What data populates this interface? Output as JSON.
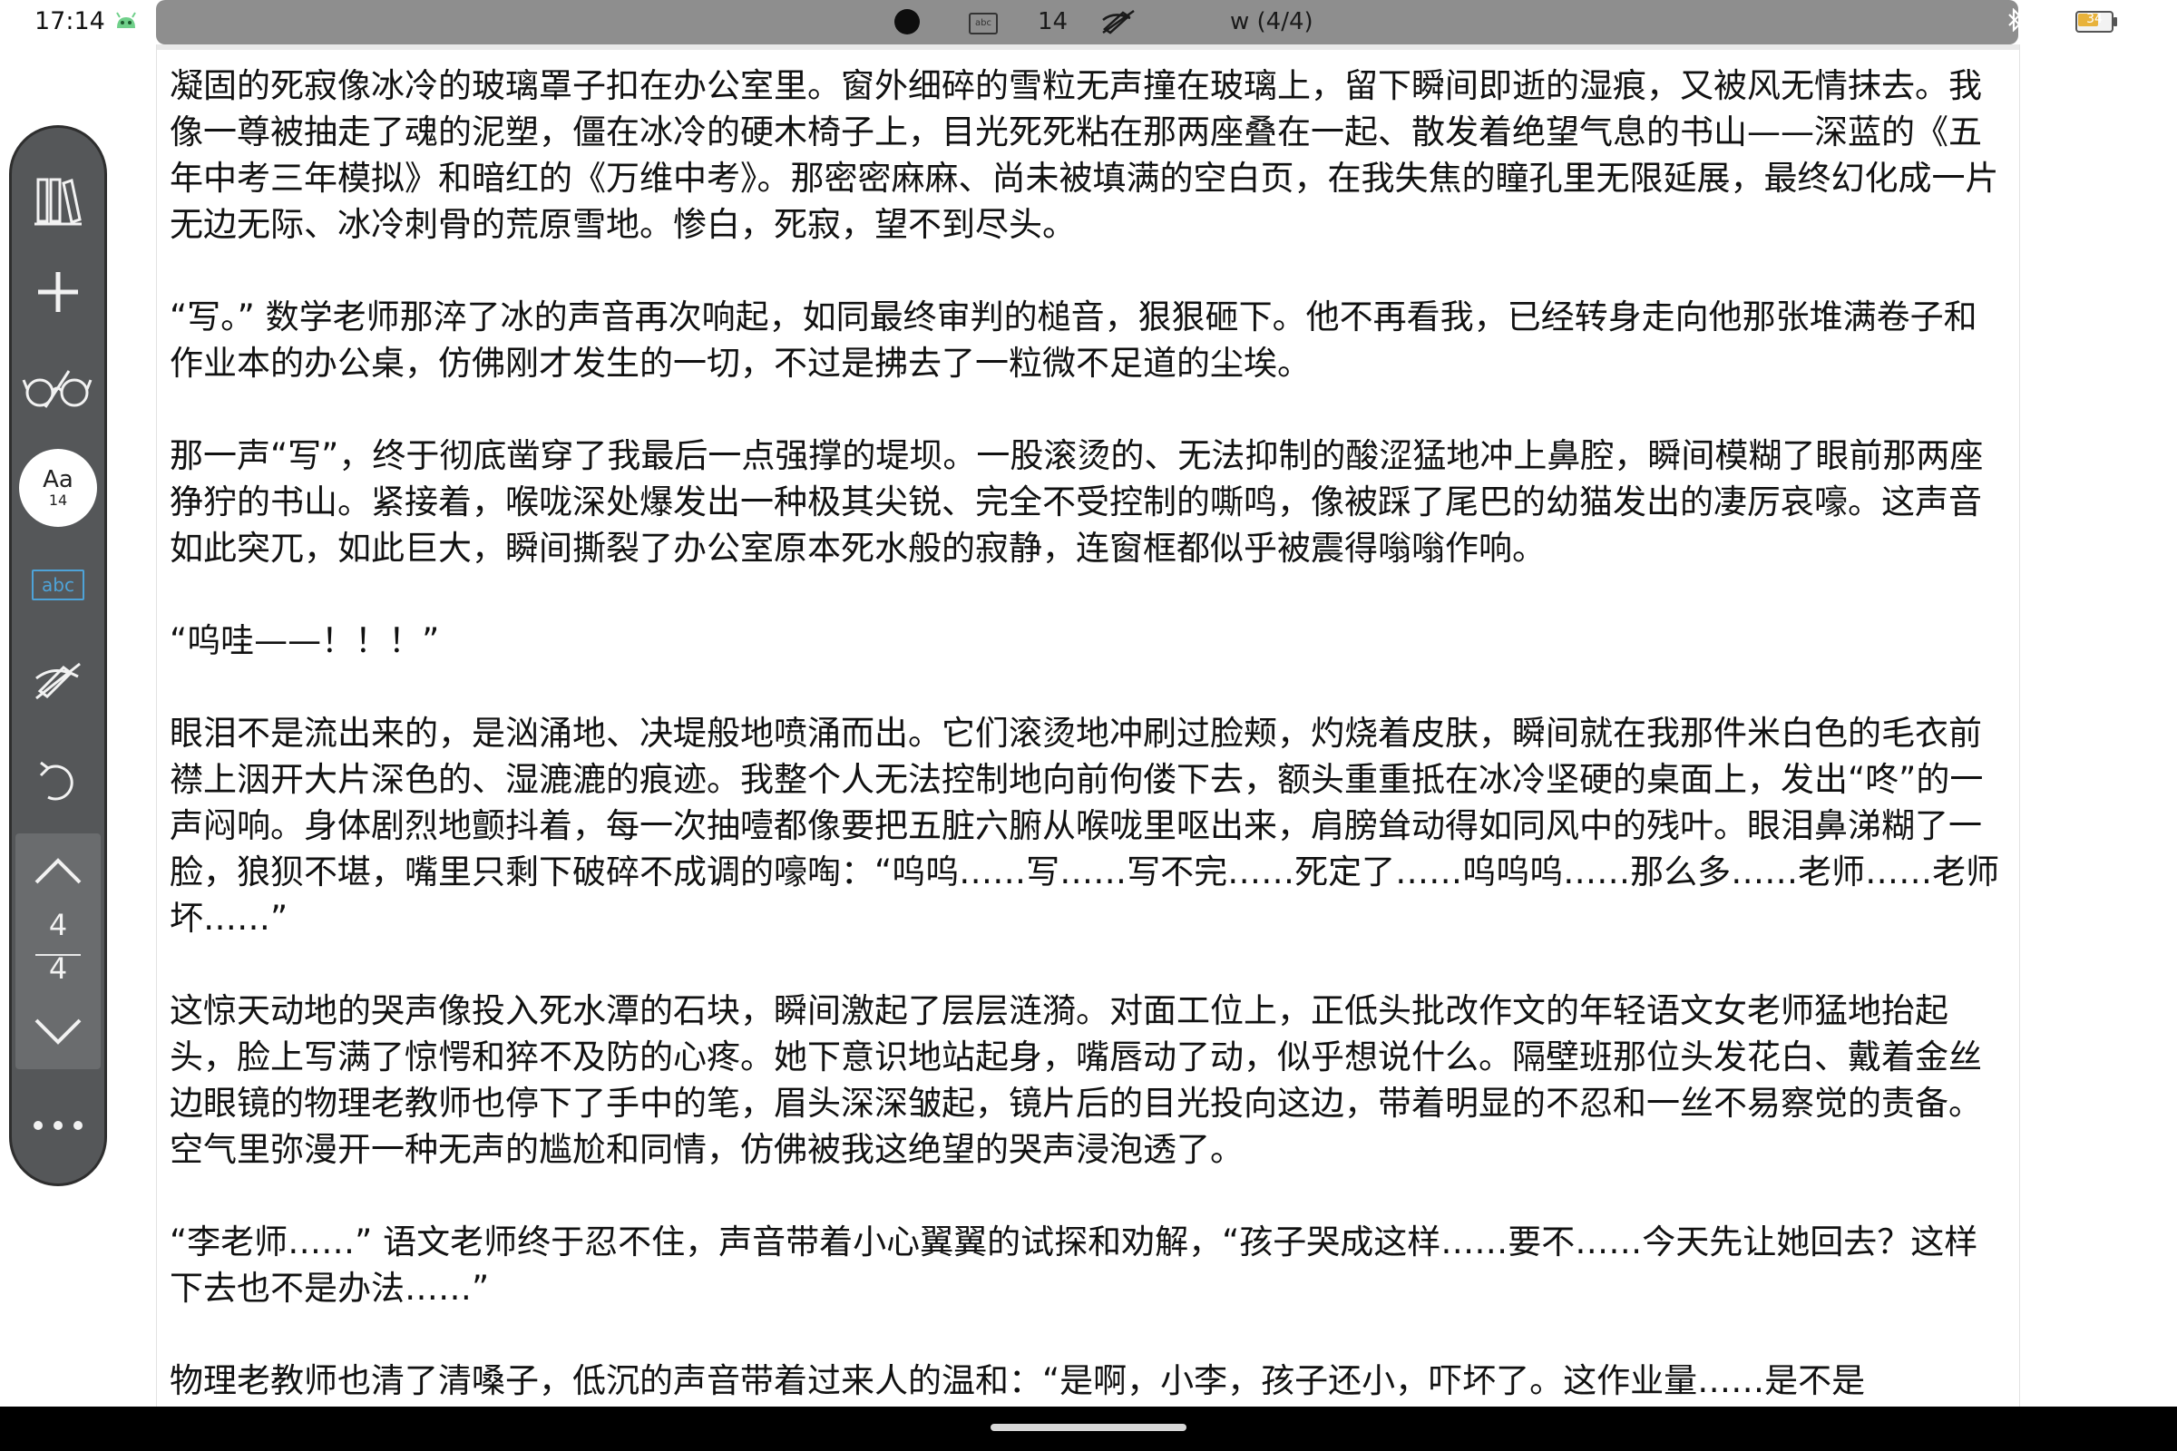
{
  "status_bar": {
    "time": "17:14",
    "font_size": "14",
    "document": "w (4/4)",
    "battery": "34",
    "icons": [
      "android-icon",
      "record-dot-icon",
      "abc-icon",
      "pen-off-icon",
      "bluetooth-icon",
      "wifi-icon",
      "battery-icon"
    ]
  },
  "toolbar": {
    "library_icon": "library-icon",
    "add_icon": "plus-icon",
    "glasses_icon": "glasses-icon",
    "font_label": "Aa",
    "font_size": "14",
    "abc_label": "abc",
    "pen_icon": "pen-off-icon",
    "undo_icon": "undo-icon",
    "page_current": "4",
    "page_total": "4",
    "more_icon": "more-dots-icon"
  },
  "content": {
    "paragraphs": [
      "凝固的死寂像冰冷的玻璃罩子扣在办公室里。窗外细碎的雪粒无声撞在玻璃上，留下瞬间即逝的湿痕，又被风无情抹去。我像一尊被抽走了魂的泥塑，僵在冰冷的硬木椅子上，目光死死粘在那两座叠在一起、散发着绝望气息的书山——深蓝的《五年中考三年模拟》和暗红的《万维中考》。那密密麻麻、尚未被填满的空白页，在我失焦的瞳孔里无限延展，最终幻化成一片无边无际、冰冷刺骨的荒原雪地。惨白，死寂，望不到尽头。",
      "“写。” 数学老师那淬了冰的声音再次响起，如同最终审判的槌音，狠狠砸下。他不再看我，已经转身走向他那张堆满卷子和作业本的办公桌，仿佛刚才发生的一切，不过是拂去了一粒微不足道的尘埃。",
      "那一声“写”，终于彻底凿穿了我最后一点强撑的堤坝。一股滚烫的、无法抑制的酸涩猛地冲上鼻腔，瞬间模糊了眼前那两座狰狞的书山。紧接着，喉咙深处爆发出一种极其尖锐、完全不受控制的嘶鸣，像被踩了尾巴的幼猫发出的凄厉哀嚎。这声音如此突兀，如此巨大，瞬间撕裂了办公室原本死水般的寂静，连窗框都似乎被震得嗡嗡作响。",
      "“呜哇——！！！”",
      "眼泪不是流出来的，是汹涌地、决堤般地喷涌而出。它们滚烫地冲刷过脸颊，灼烧着皮肤，瞬间就在我那件米白色的毛衣前襟上洇开大片深色的、湿漉漉的痕迹。我整个人无法控制地向前佝偻下去，额头重重抵在冰冷坚硬的桌面上，发出“咚”的一声闷响。身体剧烈地颤抖着，每一次抽噎都像要把五脏六腑从喉咙里呕出来，肩膀耸动得如同风中的残叶。眼泪鼻涕糊了一脸，狼狈不堪，嘴里只剩下破碎不成调的嚎啕：“呜呜……写……写不完……死定了……呜呜呜……那么多……老师……老师坏……”",
      "这惊天动地的哭声像投入死水潭的石块，瞬间激起了层层涟漪。对面工位上，正低头批改作文的年轻语文女老师猛地抬起头，脸上写满了惊愕和猝不及防的心疼。她下意识地站起身，嘴唇动了动，似乎想说什么。隔壁班那位头发花白、戴着金丝边眼镜的物理老教师也停下了手中的笔，眉头深深皱起，镜片后的目光投向这边，带着明显的不忍和一丝不易察觉的责备。空气里弥漫开一种无声的尴尬和同情，仿佛被我这绝望的哭声浸泡透了。",
      "“李老师……” 语文老师终于忍不住，声音带着小心翼翼的试探和劝解，“孩子哭成这样……要不……今天先让她回去？这样下去也不是办法……”",
      "物理老教师也清了清嗓子，低沉的声音带着过来人的温和：“是啊，小李，孩子还小，吓坏了。这作业量……是不是"
    ]
  }
}
